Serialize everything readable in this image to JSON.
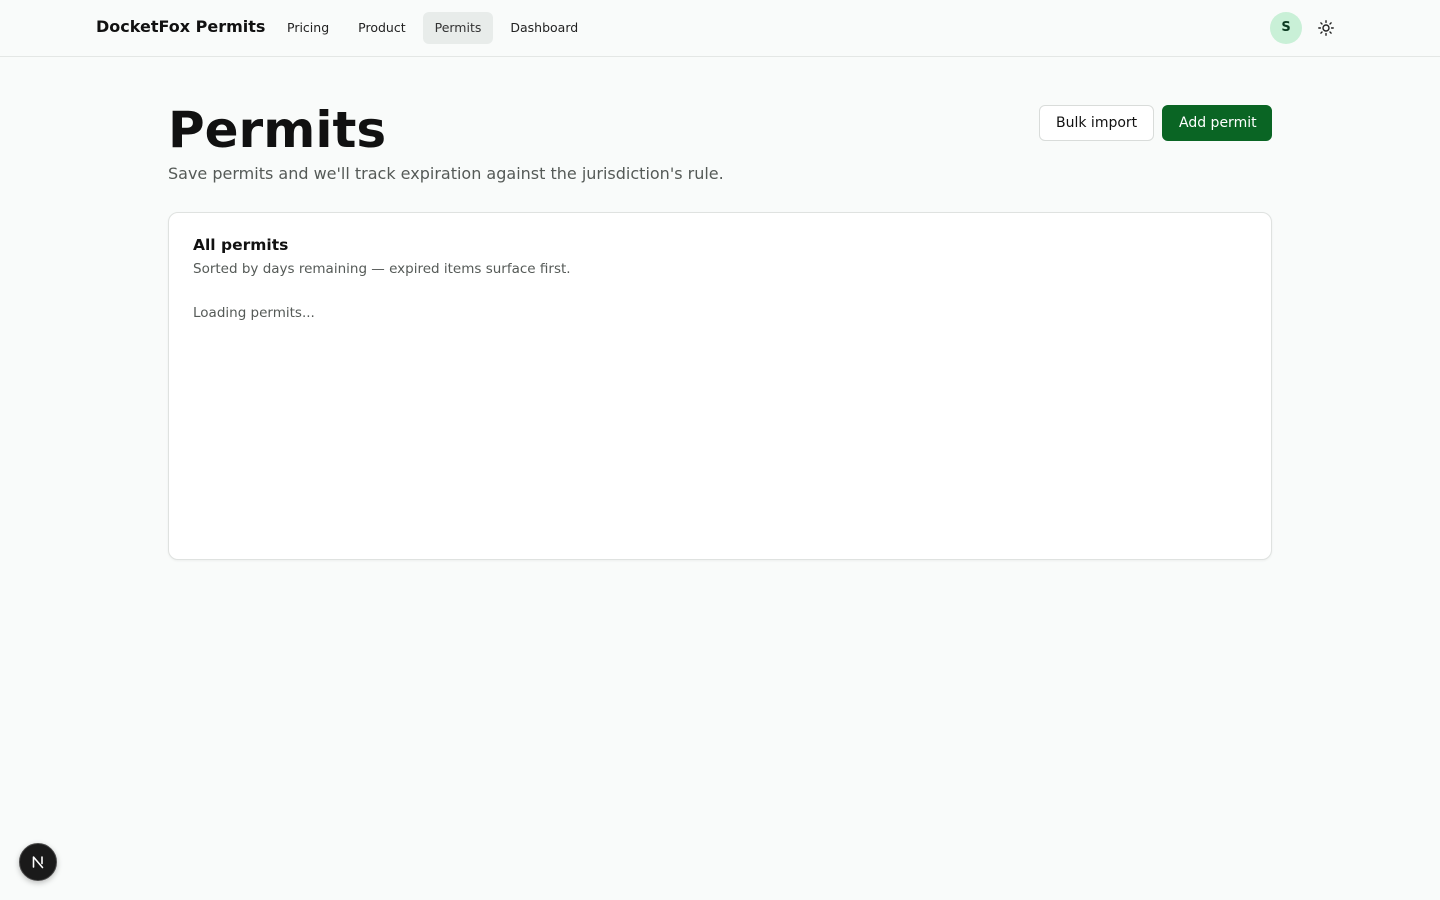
{
  "header": {
    "brand": "DocketFox Permits",
    "nav": [
      {
        "label": "Pricing",
        "active": false
      },
      {
        "label": "Product",
        "active": false
      },
      {
        "label": "Permits",
        "active": true
      },
      {
        "label": "Dashboard",
        "active": false
      }
    ],
    "avatar_initial": "S",
    "theme_icon": "sun-icon"
  },
  "page": {
    "title": "Permits",
    "subtitle": "Save permits and we'll track expiration against the jurisdiction's rule.",
    "actions": {
      "bulk_import": "Bulk import",
      "add_permit": "Add permit"
    }
  },
  "card": {
    "title": "All permits",
    "description": "Sorted by days remaining — expired items surface first.",
    "status": "Loading permits..."
  },
  "dev_badge": {
    "icon": "nextjs-n-icon"
  },
  "colors": {
    "background": "#f9fbfa",
    "primary": "#0a6524",
    "avatar_bg": "#c9f0d7",
    "nav_active_bg": "#e8ecea"
  }
}
